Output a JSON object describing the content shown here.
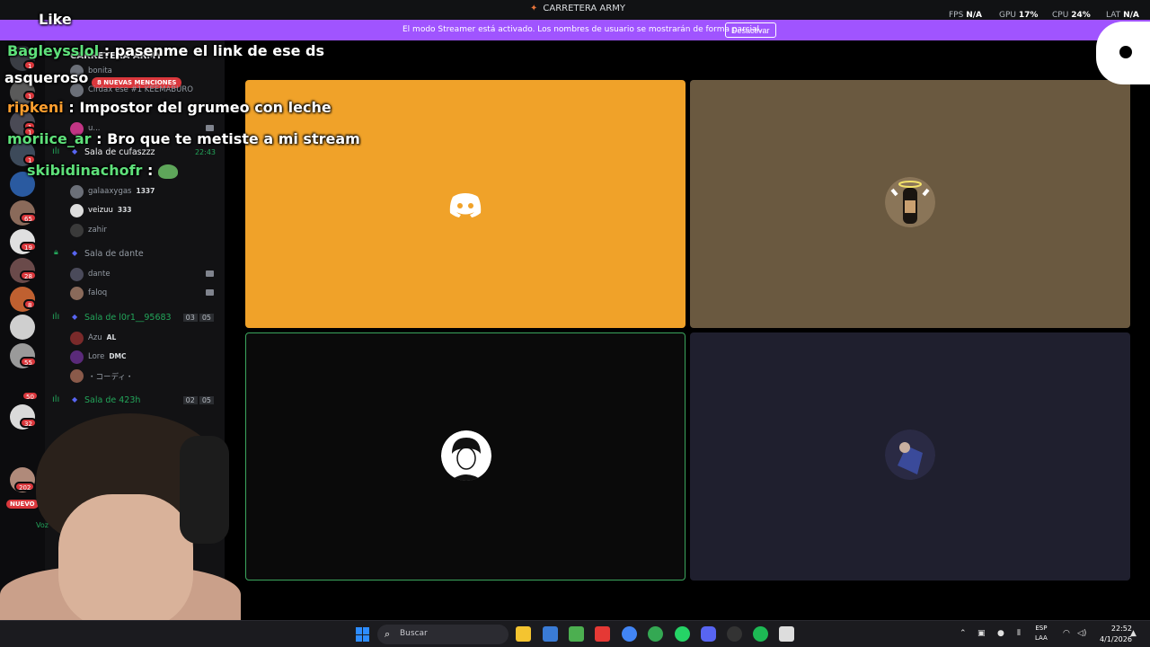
{
  "window": {
    "title": "CARRETERA ARMY",
    "perf": {
      "fps_label": "FPS",
      "fps_value": "N/A",
      "gpu_label": "GPU",
      "gpu_value": "17%",
      "cpu_label": "CPU",
      "cpu_value": "24%",
      "lat_label": "LAT",
      "lat_value": "N/A"
    }
  },
  "banner": {
    "text": "El modo Streamer está activado. Los nombres de usuario se mostrarán de forma parcial.",
    "button": "Desactivar"
  },
  "server_rail": {
    "badges": [
      "1",
      "1",
      "1",
      "1",
      "1",
      "65",
      "19",
      "28",
      "8",
      "55",
      "50",
      "32",
      "202"
    ],
    "new_label": "NUEVO"
  },
  "sidebar": {
    "server_name": "CARRETERA ARMY",
    "mentions": "8 NUEVAS MENCIONES",
    "top_members": [
      "bonita",
      "u...",
      "Cirdax ese #1 KEEMABURO"
    ],
    "rooms": [
      {
        "name": "Sala de cufaszzz",
        "time": "22:43",
        "members": [
          {
            "name": "galaaxygas",
            "extra": "1337"
          },
          {
            "name": "veizuu",
            "extra": "333"
          },
          {
            "name": "zahir",
            "extra": ""
          }
        ]
      },
      {
        "name": "Sala de dante",
        "members": [
          {
            "name": "dante"
          },
          {
            "name": "faloq"
          }
        ]
      },
      {
        "name": "Sala de l0r1__95683",
        "count_a": "03",
        "count_b": "05",
        "members": [
          {
            "name": "Azu",
            "extra": "AL"
          },
          {
            "name": "Lore",
            "extra": "DMC"
          },
          {
            "name": "・コーディ・"
          }
        ]
      },
      {
        "name": "Sala de 423h",
        "count_a": "02",
        "count_b": "05"
      }
    ],
    "voice_label": "Voz"
  },
  "chat": [
    {
      "user": "",
      "text": "Like"
    },
    {
      "user": "Bagleysslol",
      "text": ": pasenme el link de ese ds"
    },
    {
      "user": "",
      "text": "asqueroso"
    },
    {
      "user": "ripkeni",
      "text": ": Impostor del grumeo con leche"
    },
    {
      "user": "moriice_ar",
      "text": ": Bro que te metiste a mi stream"
    },
    {
      "user": "skibidinachofr",
      "text": ":"
    }
  ],
  "tiles": [
    {
      "label": "discord-default"
    },
    {
      "label": "bottle-angel"
    },
    {
      "label": "sketch-person"
    },
    {
      "label": "blue-figure"
    }
  ],
  "taskbar": {
    "search_placeholder": "Buscar",
    "lang_top": "ESP",
    "lang_bottom": "LAA",
    "time": "22:52",
    "date": "4/1/2026"
  },
  "colors": {
    "accent": "#a054ff",
    "tile1": "#f0a229",
    "tile2": "#6a5940",
    "tile4": "#1f1f2e",
    "green": "#23a55a",
    "red": "#da373c"
  }
}
